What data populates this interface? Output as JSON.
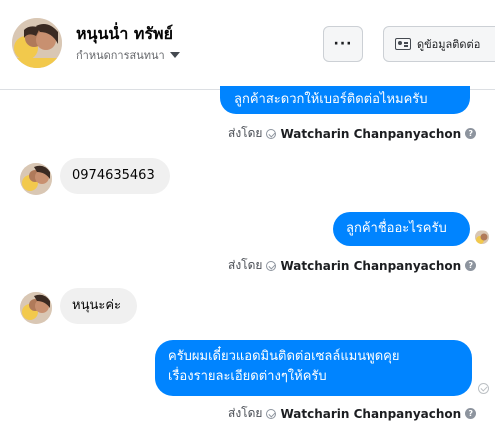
{
  "header": {
    "name": "หนุนน่ำ ทรัพย์",
    "subtitle": "กำหนดการสนทนา",
    "more_label": "···",
    "info_label": "ดูข้อมูลติดต่อ"
  },
  "messages": [
    {
      "direction": "out",
      "text": "ลูกค้าสะดวกให้เบอร์ติดต่อไหมครับ"
    },
    {
      "direction": "in",
      "text": "0974635463"
    },
    {
      "direction": "out",
      "text": "ลูกค้าชื่ออะไรครับ"
    },
    {
      "direction": "in",
      "text": "หนุนะค่ะ"
    },
    {
      "direction": "out",
      "lines": [
        "ครับผมเดี๋ยวแอดมินติดต่อเซลล์แมนพูดคุย",
        "เรื่องรายละเอียดต่างๆให้ครับ"
      ]
    }
  ],
  "sent_by": {
    "prefix": "ส่งโดย",
    "agent": "Watcharin Chanpanyachon",
    "help": "?"
  },
  "colors": {
    "outgoing_bubble": "#0084ff",
    "incoming_bubble": "#f0f0f0"
  }
}
